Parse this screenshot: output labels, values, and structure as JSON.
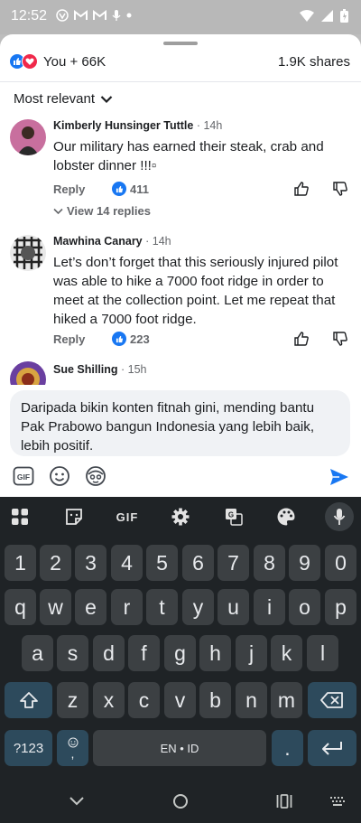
{
  "status": {
    "time": "12:52"
  },
  "post": {
    "reactions_text": "You + 66K",
    "shares_text": "1.9K shares",
    "sort_label": "Most relevant"
  },
  "comments": [
    {
      "name": "Kimberly Hunsinger Tuttle",
      "time": " · 14h",
      "text": "Our military has earned their steak, crab and lobster dinner !!!▫",
      "reply": "Reply",
      "likes": "411",
      "view_replies": "View 14 replies"
    },
    {
      "name": "Mawhina Canary",
      "time": " · 14h",
      "text": "Let’s don’t forget that this seriously injured pilot was able to hike a 7000 foot ridge in order to meet at the collection point.  Let me repeat that hiked a 7000 foot ridge.",
      "reply": "Reply",
      "likes": "223"
    },
    {
      "name": "Sue Shilling",
      "time": " · 15h"
    }
  ],
  "composer": {
    "text": "Daripada bikin konten fitnah gini, mending bantu Pak Prabowo bangun Indonesia yang lebih baik, lebih positif."
  },
  "keyboard": {
    "toolbar_gif": "GIF",
    "row_numbers": [
      "1",
      "2",
      "3",
      "4",
      "5",
      "6",
      "7",
      "8",
      "9",
      "0"
    ],
    "row1": [
      "q",
      "w",
      "e",
      "r",
      "t",
      "y",
      "u",
      "i",
      "o",
      "p"
    ],
    "row2": [
      "a",
      "s",
      "d",
      "f",
      "g",
      "h",
      "j",
      "k",
      "l"
    ],
    "row3": [
      "z",
      "x",
      "c",
      "v",
      "b",
      "n",
      "m"
    ],
    "sym_label": "?123",
    "comma_label": ",",
    "space_label": "EN • ID",
    "period_label": "."
  },
  "colors": {
    "facebook_blue": "#1877f2",
    "love_red": "#f0284a",
    "keyboard_bg": "#1f2326",
    "key_bg": "#3c4043",
    "special_key_bg": "#2d4a5c"
  }
}
